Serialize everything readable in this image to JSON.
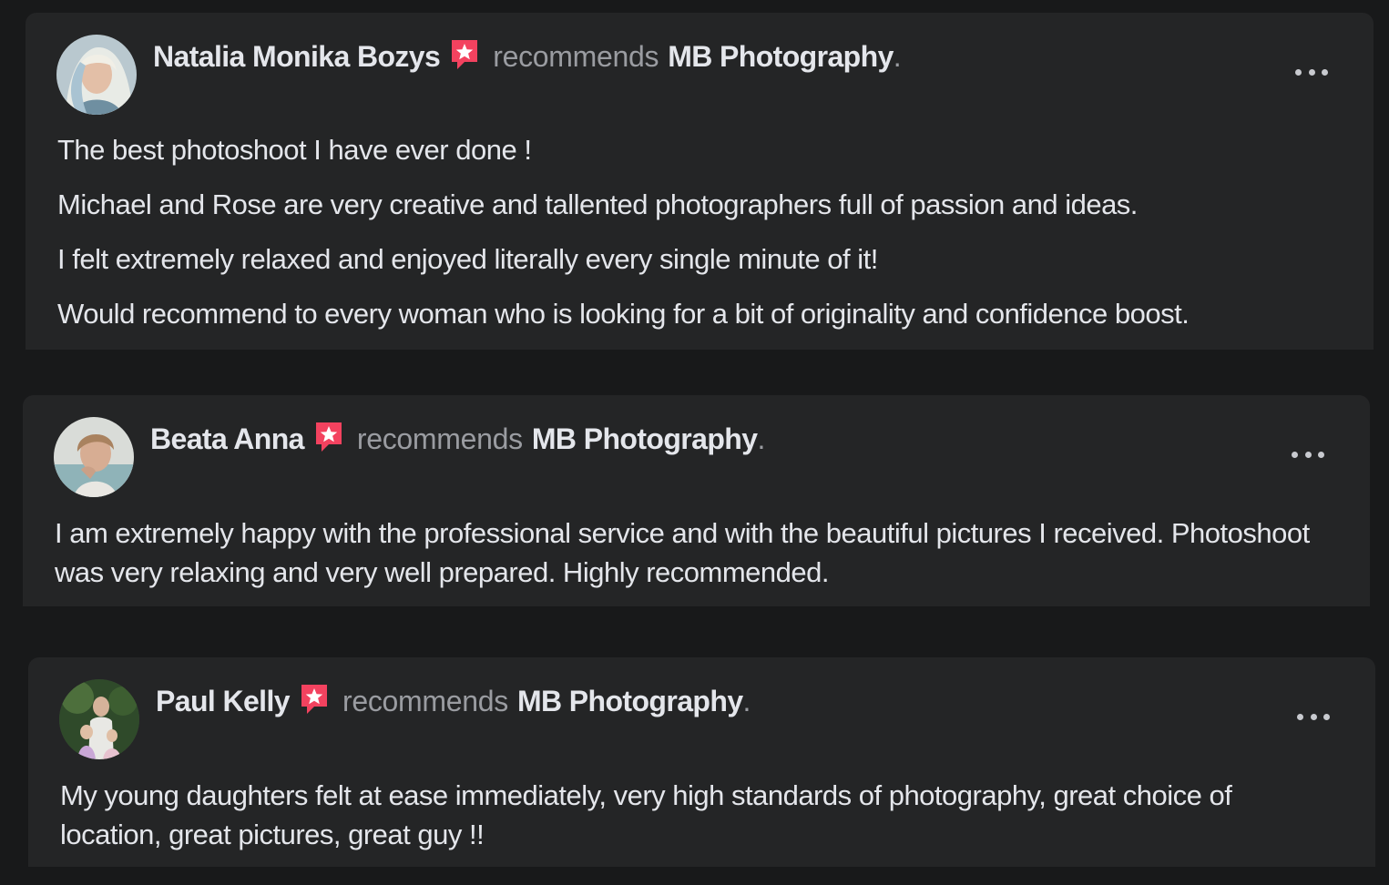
{
  "recommendations": [
    {
      "author": "Natalia Monika Bozys",
      "verb": "recommends",
      "page": "MB Photography",
      "period": ".",
      "avatar_icon": "avatar-photo-woman-blonde",
      "paragraphs": [
        "The best photoshoot I have ever done !",
        "Michael and Rose are very creative and tallented photographers full of passion and ideas.",
        "I felt extremely relaxed  and enjoyed literally every single minute of it!",
        "Would recommend to every woman who is looking for a bit of originality and confidence boost."
      ]
    },
    {
      "author": "Beata Anna",
      "verb": "recommends",
      "page": "MB Photography",
      "period": ".",
      "avatar_icon": "avatar-photo-woman-smiling",
      "paragraphs": [
        "I am extremely happy with the professional service and with the beautiful pictures I received. Photoshoot was very relaxing and very well prepared. Highly recommended."
      ]
    },
    {
      "author": "Paul Kelly",
      "verb": "recommends",
      "page": "MB Photography",
      "period": ".",
      "avatar_icon": "avatar-photo-family-outdoors",
      "paragraphs": [
        "My young daughters felt at ease immediately, very high standards of photography, great choice of location, great pictures, great guy !!"
      ]
    }
  ],
  "colors": {
    "page_background": "#18191a",
    "card_background": "#242526",
    "primary_text": "#e4e6eb",
    "secondary_text": "#9a9ca1",
    "recommend_badge": "#f3425f"
  },
  "icons": {
    "recommend_badge": "recommend-star-icon",
    "more_options": "more-options-icon"
  }
}
